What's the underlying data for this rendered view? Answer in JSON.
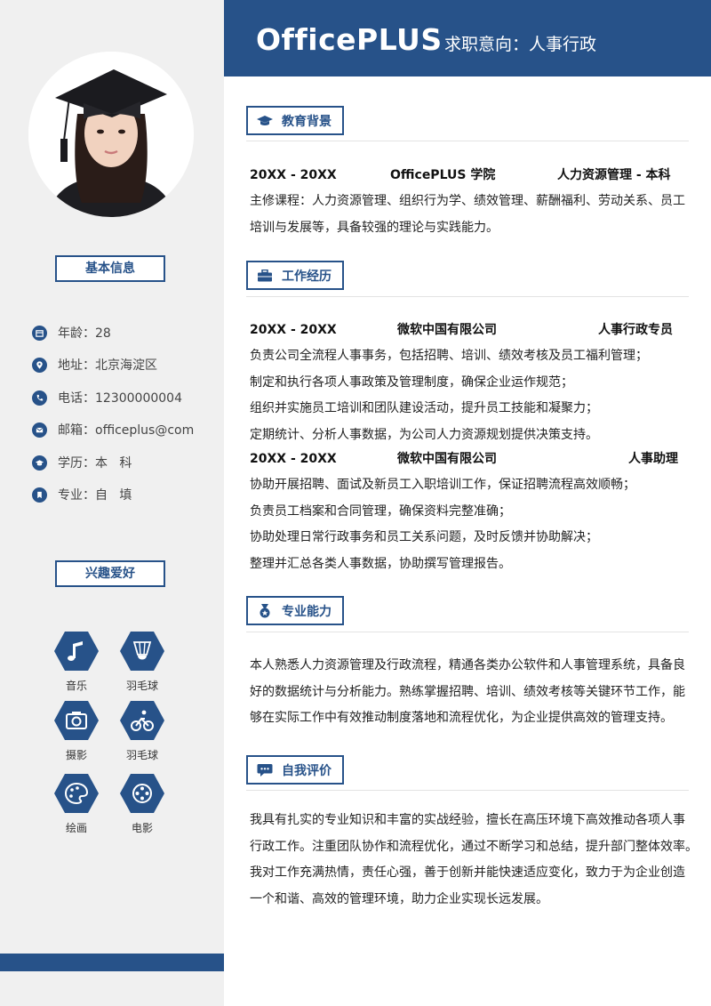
{
  "header": {
    "brand": "OfficePLUS",
    "intent": "求职意向：人事行政"
  },
  "sidebar": {
    "basic_title": "基本信息",
    "info": [
      {
        "label": "年龄：28",
        "icon": "calendar-icon"
      },
      {
        "label": "地址：北京海淀区",
        "icon": "location-pin-icon"
      },
      {
        "label": "电话：12300000004",
        "icon": "phone-icon"
      },
      {
        "label": "邮箱：officeplus@com",
        "icon": "mail-icon"
      },
      {
        "label": "学历：本   科",
        "icon": "graduation-cap-icon"
      },
      {
        "label": "专业：自   填",
        "icon": "bookmark-icon"
      }
    ],
    "hobby_title": "兴趣爱好",
    "hobbies": [
      {
        "label": "音乐",
        "icon": "music-note-icon"
      },
      {
        "label": "羽毛球",
        "icon": "shuttlecock-icon"
      },
      {
        "label": "摄影",
        "icon": "camera-icon"
      },
      {
        "label": "羽毛球",
        "icon": "bicycle-icon"
      },
      {
        "label": "绘画",
        "icon": "palette-icon"
      },
      {
        "label": "电影",
        "icon": "film-reel-icon"
      }
    ]
  },
  "education": {
    "title": "教育背景",
    "years": "20XX - 20XX",
    "school": "OfficePLUS 学院",
    "major": "人力资源管理  -  本科",
    "lines": [
      "主修课程：人力资源管理、组织行为学、绩效管理、薪酬福利、劳动关系、员工",
      "培训与发展等，具备较强的理论与实践能力。"
    ]
  },
  "work": {
    "title": "工作经历",
    "jobs": [
      {
        "years": "20XX - 20XX",
        "company": "微软中国有限公司",
        "position": "人事行政专员",
        "lines": [
          "负责公司全流程人事事务，包括招聘、培训、绩效考核及员工福利管理；",
          "制定和执行各项人事政策及管理制度，确保企业运作规范；",
          "组织并实施员工培训和团队建设活动，提升员工技能和凝聚力；",
          "定期统计、分析人事数据，为公司人力资源规划提供决策支持。"
        ]
      },
      {
        "years": "20XX - 20XX",
        "company": "微软中国有限公司",
        "position": "人事助理",
        "lines": [
          "协助开展招聘、面试及新员工入职培训工作，保证招聘流程高效顺畅；",
          "负责员工档案和合同管理，确保资料完整准确；",
          "协助处理日常行政事务和员工关系问题，及时反馈并协助解决；",
          "整理并汇总各类人事数据，协助撰写管理报告。"
        ]
      }
    ]
  },
  "skills": {
    "title": "专业能力",
    "lines": [
      "本人熟悉人力资源管理及行政流程，精通各类办公软件和人事管理系统，具备良",
      "好的数据统计与分析能力。熟练掌握招聘、培训、绩效考核等关键环节工作，能",
      "够在实际工作中有效推动制度落地和流程优化，为企业提供高效的管理支持。"
    ]
  },
  "self_eval": {
    "title": "自我评价",
    "lines": [
      "我具有扎实的专业知识和丰富的实战经验，擅长在高压环境下高效推动各项人事",
      "行政工作。注重团队协作和流程优化，通过不断学习和总结，提升部门整体效率。",
      "我对工作充满热情，责任心强，善于创新并能快速适应变化，致力于为企业创造",
      "一个和谐、高效的管理环境，助力企业实现长远发展。"
    ]
  },
  "colors": {
    "accent": "#275289",
    "sidebar_bg": "#f0f0f0"
  }
}
